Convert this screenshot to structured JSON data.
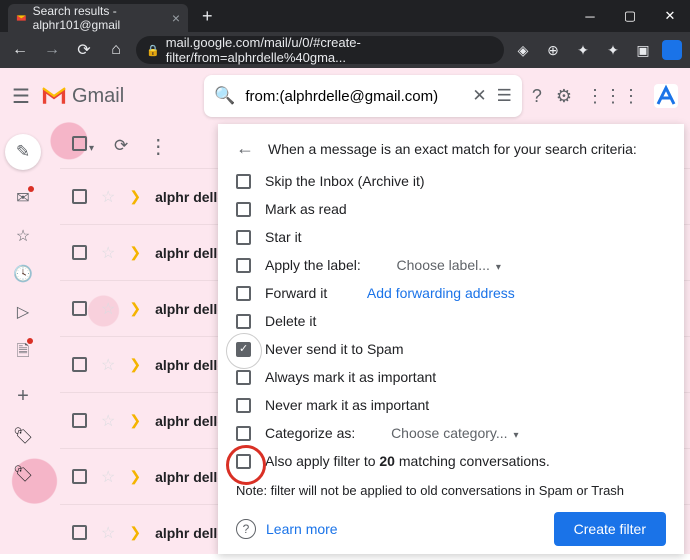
{
  "browser": {
    "tab_title": "Search results - alphr101@gmail",
    "url": "mail.google.com/mail/u/0/#create-filter/from=alphrdelle%40gma..."
  },
  "gmail": {
    "logo_text": "Gmail",
    "search_value": "from:(alphrdelle@gmail.com)"
  },
  "mail_rows": [
    {
      "sender": "alphr delle"
    },
    {
      "sender": "alphr delle"
    },
    {
      "sender": "alphr delle"
    },
    {
      "sender": "alphr delle"
    },
    {
      "sender": "alphr delle"
    },
    {
      "sender": "alphr delle"
    },
    {
      "sender": "alphr delle"
    }
  ],
  "panel": {
    "title": "When a message is an exact match for your search criteria:",
    "options": {
      "skip": "Skip the Inbox (Archive it)",
      "read": "Mark as read",
      "star": "Star it",
      "label": "Apply the label:",
      "label_select": "Choose label...",
      "forward": "Forward it",
      "forward_link": "Add forwarding address",
      "delete": "Delete it",
      "nospam": "Never send it to Spam",
      "important": "Always mark it as important",
      "notimportant": "Never mark it as important",
      "categorize": "Categorize as:",
      "categorize_select": "Choose category...",
      "apply_prefix": "Also apply filter to ",
      "apply_count": "20",
      "apply_suffix": " matching conversations."
    },
    "note": "Note: filter will not be applied to old conversations in Spam or Trash",
    "learn_more": "Learn more",
    "create_button": "Create filter"
  }
}
